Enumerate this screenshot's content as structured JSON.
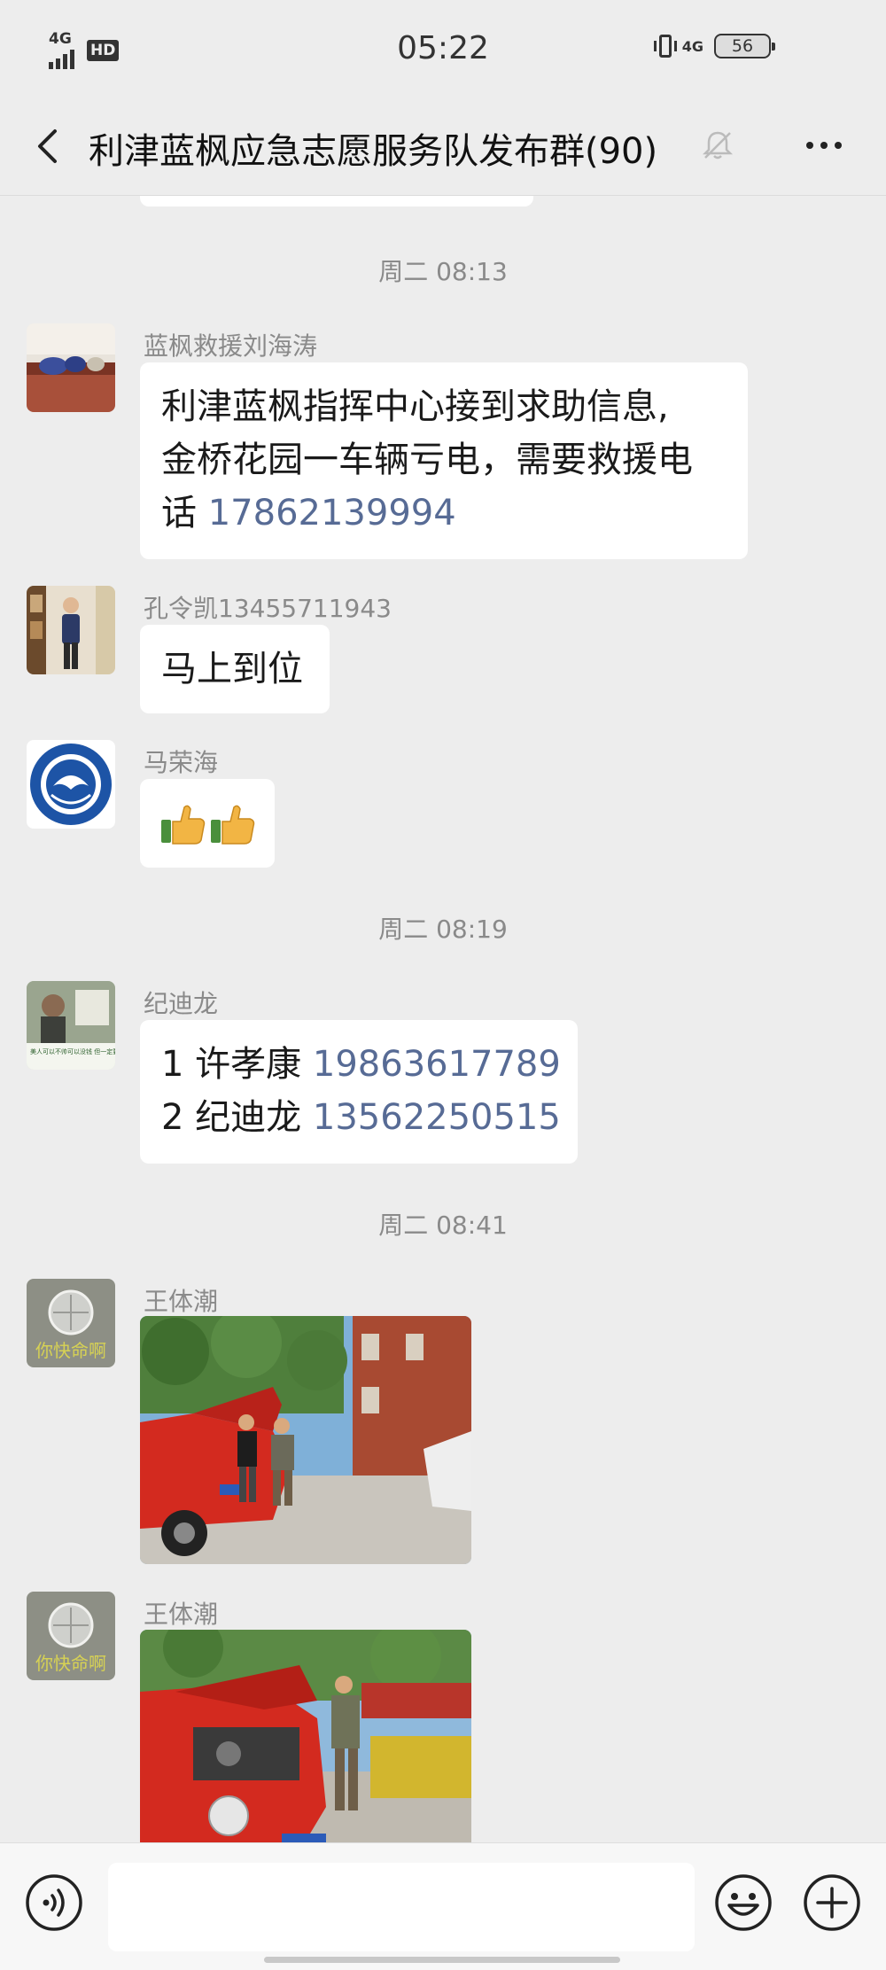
{
  "status_bar": {
    "network": "4G",
    "hd": "HD",
    "time": "05:22",
    "network2": "4G",
    "battery": "56"
  },
  "header": {
    "title": "利津蓝枫应急志愿服务队发布群(90)"
  },
  "messages": {
    "ts1": "周二 08:13",
    "m1": {
      "sender": "蓝枫救援刘海涛",
      "line1": "利津蓝枫指挥中心接到求助信息,",
      "line2": "金桥花园一车辆亏电，需要救援电",
      "line3_text": "话 ",
      "line3_phone": "17862139994"
    },
    "m2": {
      "sender": "孔令凯13455711943",
      "text": "马上到位"
    },
    "m3": {
      "sender": "马荣海",
      "text": "👍👍"
    },
    "ts2": "周二 08:19",
    "m4": {
      "sender": "纪迪龙",
      "line1_text": "1 许孝康 ",
      "line1_phone": "19863617789",
      "line2_text": "2 纪迪龙 ",
      "line2_phone": "13562250515"
    },
    "ts3": "周二 08:41",
    "m5": {
      "sender": "王体潮"
    },
    "m6": {
      "sender": "王体潮"
    }
  },
  "avatar_texts": {
    "jidilong": "美人可以不帅可以没钱 但一定要懂经验",
    "wangtichao": "你快命啊"
  },
  "input_bar": {
    "placeholder": ""
  },
  "colors": {
    "background": "#ededed",
    "link": "#576b95",
    "bubble": "#ffffff"
  }
}
